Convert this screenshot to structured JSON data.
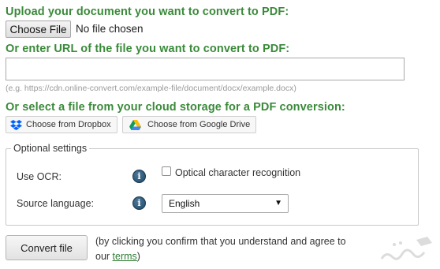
{
  "upload_section": {
    "heading": "Upload your document you want to convert to PDF:",
    "choose_file_label": "Choose File",
    "file_status": "No file chosen"
  },
  "url_section": {
    "heading": "Or enter URL of the file you want to convert to PDF:",
    "url_value": "",
    "example": "(e.g. https://cdn.online-convert.com/example-file/document/docx/example.docx)"
  },
  "cloud_section": {
    "heading": "Or select a file from your cloud storage for a PDF conversion:",
    "dropbox_label": "Choose from Dropbox",
    "gdrive_label": "Choose from Google Drive"
  },
  "optional_settings": {
    "legend": "Optional settings",
    "ocr_label": "Use OCR:",
    "ocr_checkbox_label": "Optical character recognition",
    "ocr_checked": false,
    "source_language_label": "Source language:",
    "source_language_value": "English",
    "info_glyph": "i"
  },
  "convert": {
    "button_label": "Convert file",
    "note_prefix": "(by clicking you confirm that you understand and agree to our ",
    "terms_link": "terms",
    "note_suffix": ")"
  },
  "icons": {
    "dropbox": "dropbox-icon",
    "gdrive": "google-drive-icon",
    "info": "info-icon",
    "dropdown": "chevron-down-icon"
  },
  "colors": {
    "heading_green": "#3a8a3a",
    "link_green": "#2e7d32",
    "info_blue": "#1f4765",
    "dropbox_blue": "#0061fe"
  }
}
